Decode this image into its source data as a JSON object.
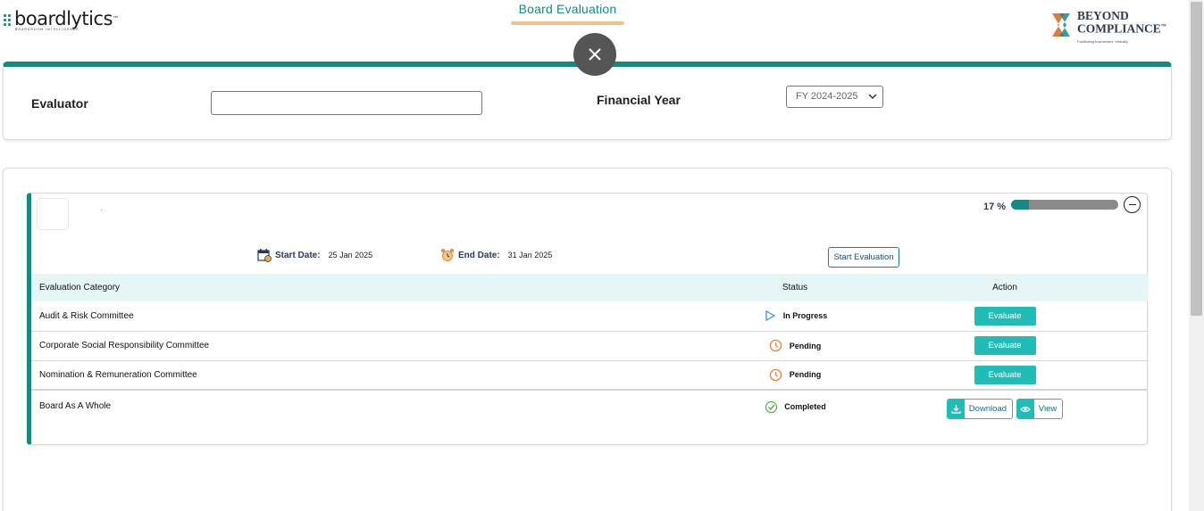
{
  "header": {
    "logo_left_text": "boardlytics",
    "logo_left_tagline": "BOARDROOM INTELLIGENCE",
    "title": "Board Evaluation",
    "logo_right_line1": "BEYOND",
    "logo_right_line2": "COMPLIANCE",
    "logo_right_tagline": "Facilitating businesses, ethically",
    "trademark": "™"
  },
  "filters": {
    "evaluator_label": "Evaluator",
    "evaluator_value": "",
    "financial_year_label": "Financial Year",
    "financial_year_value": "FY 2024-2025"
  },
  "evaluation": {
    "progress_text": "17 %",
    "progress_value": 0.17,
    "start_date_label": "Start Date:",
    "start_date_value": "25 Jan 2025",
    "end_date_label": "End Date:",
    "end_date_value": "31 Jan 2025",
    "start_button_label": "Start Evaluation",
    "table": {
      "headers": {
        "category": "Evaluation Category",
        "status": "Status",
        "action": "Action"
      },
      "rows": [
        {
          "category": "Audit & Risk Committee",
          "status": "In Progress",
          "status_icon": "play-icon",
          "action": "Evaluate"
        },
        {
          "category": "Corporate Social Responsibility Committee",
          "status": "Pending",
          "status_icon": "clock-icon",
          "action": "Evaluate"
        },
        {
          "category": "Nomination & Remuneration Committee",
          "status": "Pending",
          "status_icon": "clock-icon",
          "action": "Evaluate"
        },
        {
          "category": "Board As A Whole",
          "status": "Completed",
          "status_icon": "check-circle-icon",
          "download_label": "Download",
          "view_label": "View"
        }
      ]
    }
  },
  "colors": {
    "accent_teal": "#158a7f",
    "button_teal": "#20bdb6",
    "tab_underline": "#f3c28e",
    "header_row_bg": "#e6f6f6",
    "close_button": "#555555"
  }
}
